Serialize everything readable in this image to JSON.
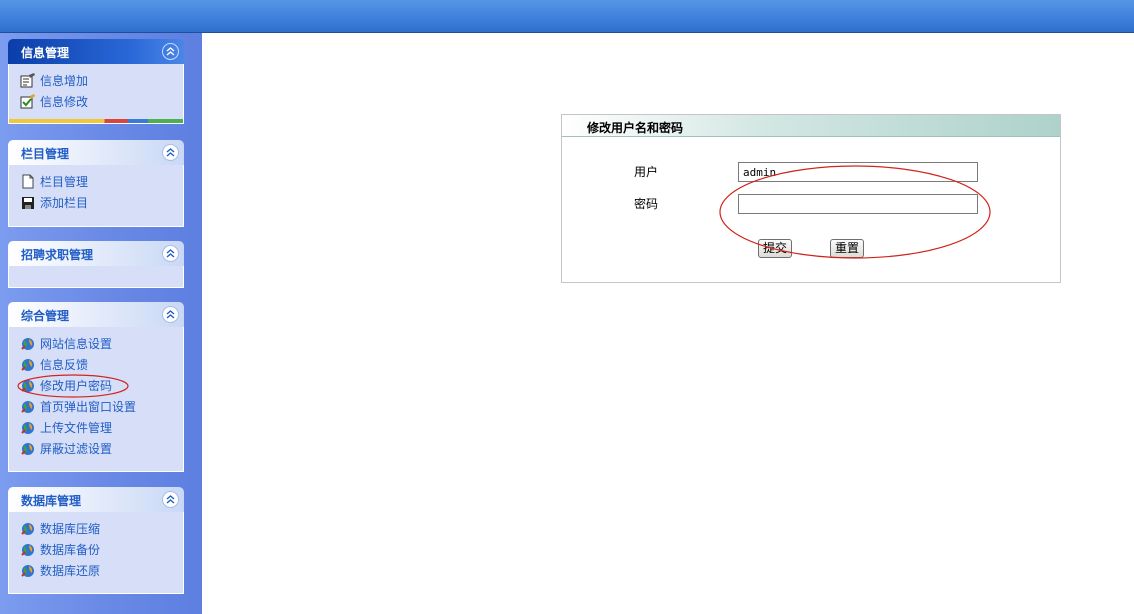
{
  "sidebar": {
    "panels": [
      {
        "title": "信息管理",
        "items": [
          {
            "label": "信息增加",
            "icon": "edit-add-icon"
          },
          {
            "label": "信息修改",
            "icon": "edit-check-icon"
          }
        ]
      },
      {
        "title": "栏目管理",
        "items": [
          {
            "label": "栏目管理",
            "icon": "document-icon"
          },
          {
            "label": "添加栏目",
            "icon": "save-disk-icon"
          }
        ]
      },
      {
        "title": "招聘求职管理",
        "items": []
      },
      {
        "title": "综合管理",
        "items": [
          {
            "label": "网站信息设置",
            "icon": "globe-icon"
          },
          {
            "label": "信息反馈",
            "icon": "globe-icon"
          },
          {
            "label": "修改用户密码",
            "icon": "globe-icon"
          },
          {
            "label": "首页弹出窗口设置",
            "icon": "globe-icon"
          },
          {
            "label": "上传文件管理",
            "icon": "globe-icon"
          },
          {
            "label": "屏蔽过滤设置",
            "icon": "globe-icon"
          }
        ]
      },
      {
        "title": "数据库管理",
        "items": [
          {
            "label": "数据库压缩",
            "icon": "globe-icon"
          },
          {
            "label": "数据库备份",
            "icon": "globe-icon"
          },
          {
            "label": "数据库还原",
            "icon": "globe-icon"
          }
        ]
      }
    ]
  },
  "form": {
    "title": "修改用户名和密码",
    "user_label": "用户",
    "user_value": "admin",
    "password_label": "密码",
    "password_value": "",
    "submit_label": "提交",
    "reset_label": "重置"
  },
  "colors": {
    "link": "#215dc6",
    "annotation": "#d0241c",
    "topbar": "#3d80da"
  }
}
